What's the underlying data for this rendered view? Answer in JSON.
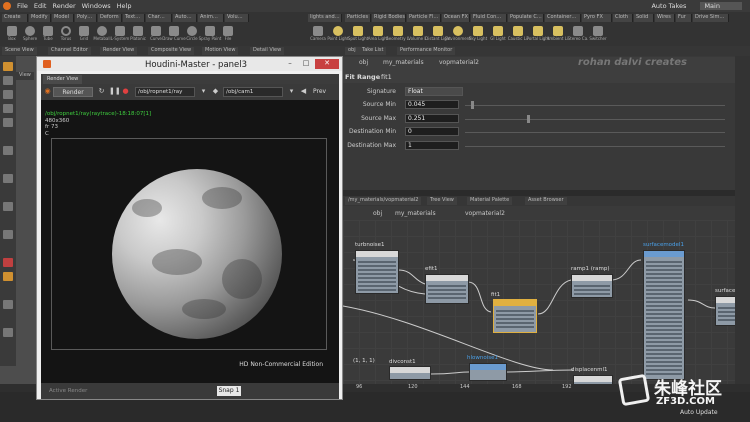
{
  "menubar": {
    "items": [
      "File",
      "Edit",
      "Render",
      "Windows",
      "Help"
    ],
    "auto_takes": "Auto Takes",
    "main": "Main"
  },
  "shelf": {
    "tabs_left": [
      "Create",
      "Modify",
      "Model",
      "Poly…",
      "Deform",
      "Text…",
      "Char…",
      "Auto…",
      "Anim…",
      "Volu…"
    ],
    "tabs_right": [
      "lights and…",
      "Particles",
      "Rigid Bodies",
      "Particle Fl…",
      "Ocean FX",
      "Fluid Con…",
      "Populate C…",
      "Container…",
      "Pyro FX",
      "Cloth",
      "Solid",
      "Wires",
      "Fur",
      "Drive Sim…"
    ],
    "tools_left": [
      "Box",
      "Sphere",
      "Tube",
      "Torus",
      "Grid",
      "Metaball",
      "L-System",
      "Platonic",
      "Curve",
      "Draw Curve",
      "Circle",
      "Spray Paint",
      "File"
    ],
    "tools_right": [
      "Camera",
      "Point Light",
      "Spot Light",
      "Area Light",
      "Geometry L.",
      "Volume L.",
      "Distant Light",
      "Environment",
      "Sky Light",
      "GI Light",
      "Caustic Li.",
      "Portal Light",
      "Ambient Li.",
      "Stereo Ca.",
      "Switcher"
    ]
  },
  "pane_tabs": [
    "Scene View",
    "Channel Editor",
    "Render View",
    "Composite View",
    "Motion View",
    "Detail View"
  ],
  "param_tabs": [
    "obj",
    "Take List",
    "Performance Monitor"
  ],
  "viewport_tab": "View",
  "float_window": {
    "title": "Houdini-Master - panel3",
    "tab": "Render View",
    "render_button": "Render",
    "rop_path": "/obj/ropnet1/ray",
    "cam_path": "/obj/cam1",
    "prev_label": "Prev",
    "info_line1": "/obj/ropnet1/ray(raytrace)-18:18:07[1]",
    "info_line2": "480x360",
    "info_line3": "fr 73",
    "info_line4": "C",
    "edition": "HD Non-Commercial Edition",
    "active_render": "Active Render",
    "snap": "Snap",
    "snap_value": "1"
  },
  "params": {
    "path_obj": "obj",
    "path_mat": "my_materials",
    "path_vop": "vopmaterial2",
    "node_type": "Fit Range",
    "node_name": "fit1",
    "signature_label": "Signature",
    "signature_value": "Float",
    "rows": [
      {
        "label": "Source Min",
        "value": "0.045"
      },
      {
        "label": "Source Max",
        "value": "0.251"
      },
      {
        "label": "Destination Min",
        "value": "0"
      },
      {
        "label": "Destination Max",
        "value": "1"
      }
    ],
    "watermark": "rohan dalvi creates"
  },
  "net_tabs": [
    "/my_materials/vopmaterial2",
    "Tree View",
    "Material Palette",
    "Asset Browser"
  ],
  "net_path": {
    "obj": "obj",
    "mat": "my_materials",
    "vop": "vopmaterial2"
  },
  "nodes": {
    "turbnoise": "turbnoise1",
    "efit": "efit1",
    "fit": "fit1",
    "ramp": "ramp1",
    "ramp_sub": "(ramp)",
    "surface": "surfacemodel1",
    "surface_out": "surface_output",
    "divconst": "divconst1",
    "divconst_sub": "(1, 1, 1)",
    "hlow": "hlownoise1",
    "displace": "displacenml1"
  },
  "timeline": [
    "96",
    "120",
    "144",
    "168",
    "192"
  ],
  "status": {
    "auto_update": "Auto Update"
  },
  "site_watermark": {
    "cn": "朱峰社区",
    "en": "ZF3D.COM"
  }
}
